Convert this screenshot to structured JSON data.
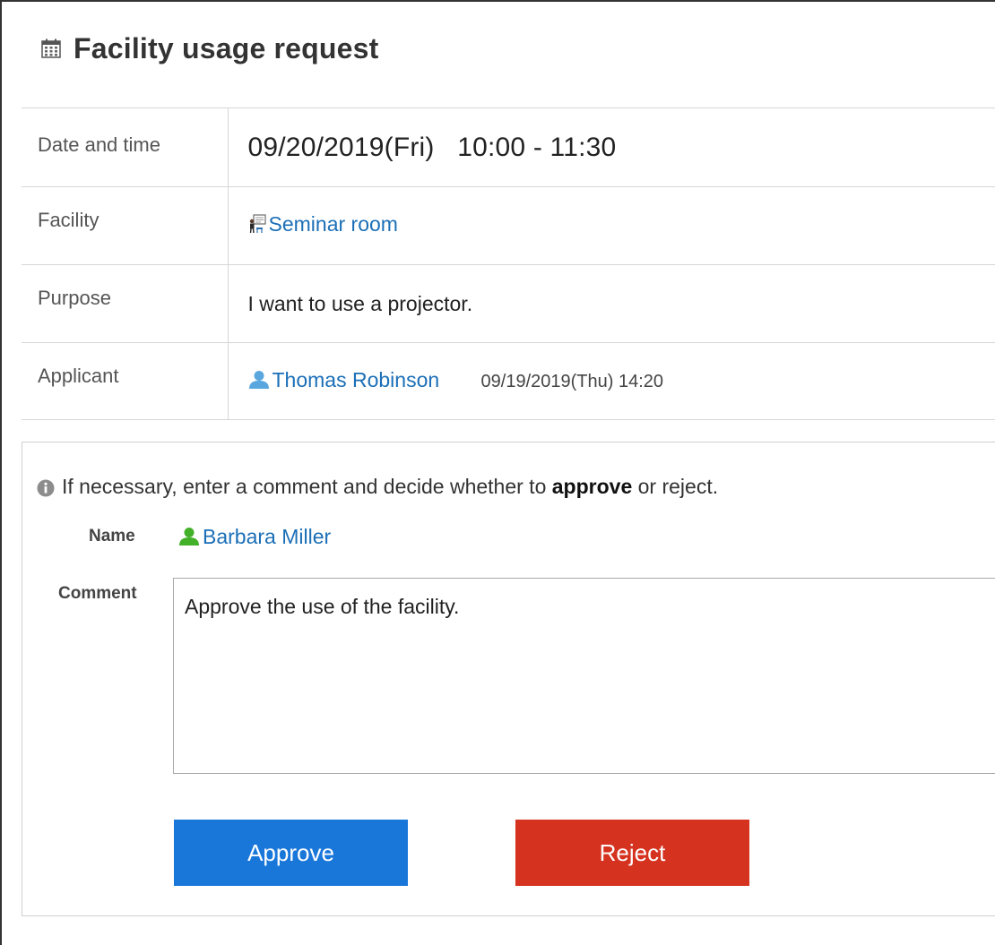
{
  "header": {
    "title": "Facility usage request",
    "icon": "calendar-icon"
  },
  "details": {
    "date_label": "Date and time",
    "date_value": "09/20/2019(Fri)   10:00 - 11:30",
    "facility_label": "Facility",
    "facility_value": "Seminar room",
    "facility_icon": "facility-room-icon",
    "purpose_label": "Purpose",
    "purpose_value": "I want to use a projector.",
    "applicant_label": "Applicant",
    "applicant_name": "Thomas Robinson",
    "applicant_icon": "user-icon",
    "applied_datetime": "09/19/2019(Thu) 14:20"
  },
  "approval": {
    "info_prefix": "If necessary, enter a comment and decide whether to ",
    "info_bold": "approve",
    "info_suffix": " or reject.",
    "name_label": "Name",
    "name_value": "Barbara Miller",
    "name_icon": "user-icon",
    "comment_label": "Comment",
    "comment_value": "Approve the use of the facility.",
    "approve_label": "Approve",
    "reject_label": "Reject"
  },
  "colors": {
    "link": "#1b6fb7",
    "approve_button": "#1a77da",
    "reject_button": "#d5321f",
    "applicant_icon": "#5aa7e0",
    "approver_icon": "#43b02a"
  }
}
